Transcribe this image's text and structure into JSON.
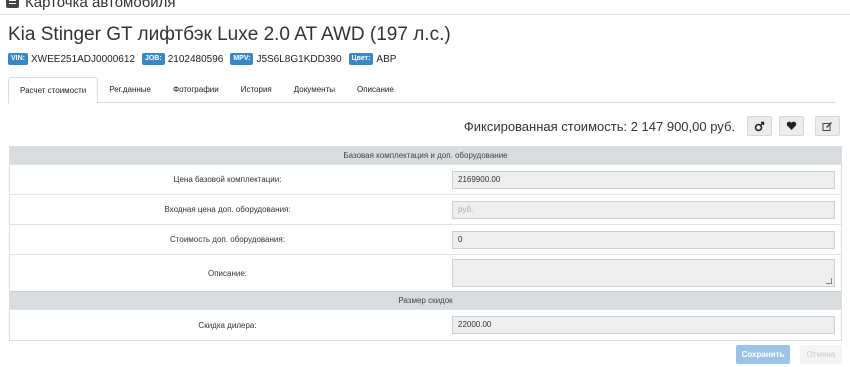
{
  "window": {
    "title": "Карточка автомобиля"
  },
  "car": {
    "title": "Kia Stinger GT лифтбэк Luxe 2.0 AT AWD (197 л.с.)"
  },
  "ids": {
    "vin_label": "VIN:",
    "vin": "XWEE251ADJ0000612",
    "job_label": "JOB:",
    "job": "2102480596",
    "mpv_label": "MPV:",
    "mpv": "J5S6L8G1KDD390",
    "color_label": "Цвет:",
    "color": "ABP"
  },
  "tabs": [
    {
      "label": "Расчет стоимости",
      "active": true
    },
    {
      "label": "Рег.данные"
    },
    {
      "label": "Фотографии"
    },
    {
      "label": "История"
    },
    {
      "label": "Документы"
    },
    {
      "label": "Описание"
    }
  ],
  "fixed_price": {
    "label": "Фиксированная стоимость: 2 147 900,00 руб."
  },
  "icons": {
    "btn1": "link-icon",
    "btn2": "heart-icon",
    "btn3": "edit-icon"
  },
  "sections": {
    "base": "Базовая комплектация и доп. оборудование",
    "discounts": "Размер скидок"
  },
  "fields": {
    "base_price": {
      "label": "Цена базовой комплектации:",
      "value": "2169900.00"
    },
    "input_extra": {
      "label": "Входная цена доп. оборудования:",
      "placeholder": "руб."
    },
    "extra_cost": {
      "label": "Стоимость доп. оборудования:",
      "value": "0"
    },
    "description": {
      "label": "Описание:",
      "value": ""
    },
    "dealer_discount": {
      "label": "Скидка дилера:",
      "value": "22000.00"
    }
  },
  "buttons": {
    "save": "Сохранить",
    "cancel": "Отмена"
  },
  "colors": {
    "accent": "#3a87c5",
    "save_btn": "#9cc4e8",
    "section_header": "#d9dcdf"
  }
}
